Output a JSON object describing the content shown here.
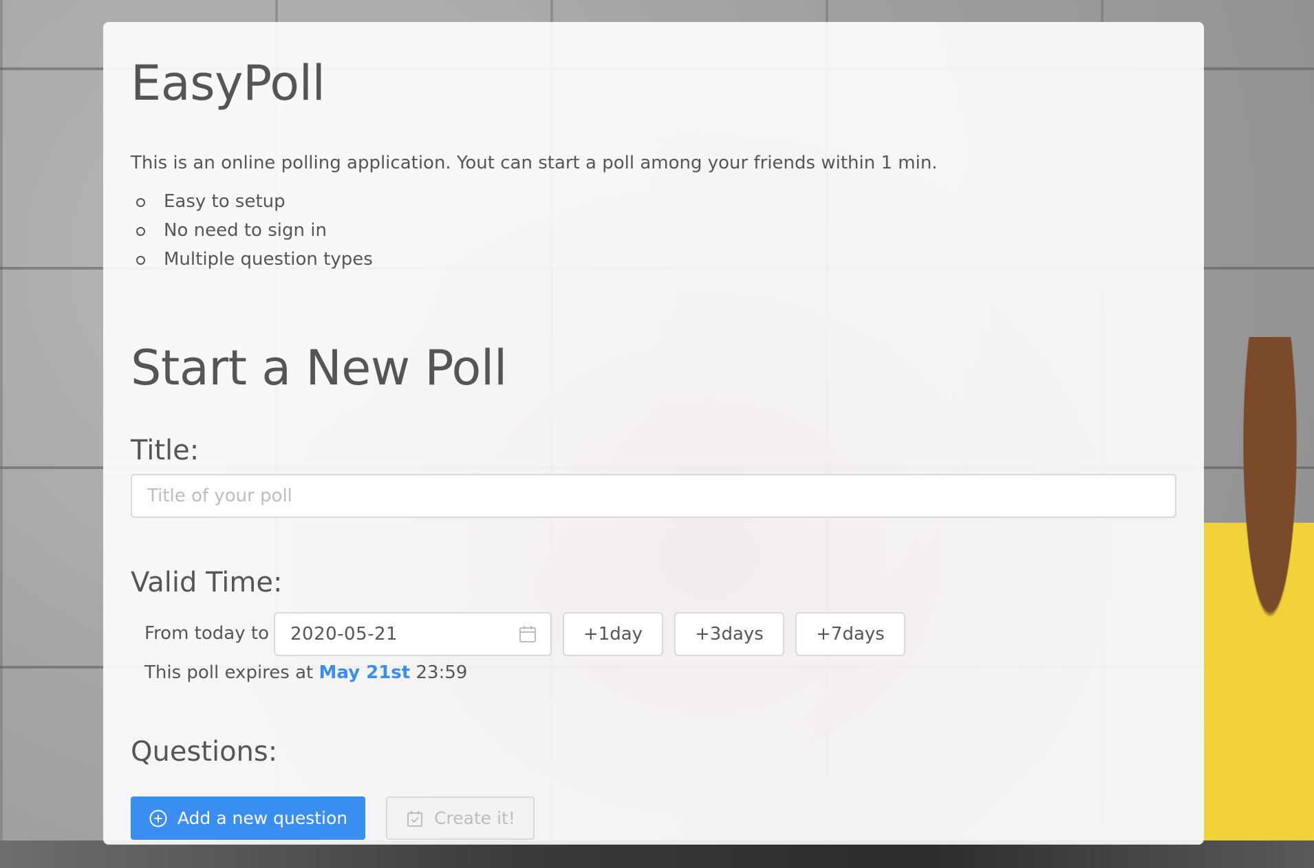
{
  "app": {
    "title": "EasyPoll",
    "intro": "This is an online polling application. Yout can start a poll among your friends within 1 min.",
    "features": [
      "Easy to setup",
      "No need to sign in",
      "Multiple question types"
    ]
  },
  "new_poll": {
    "heading": "Start a New Poll",
    "title_section": {
      "label": "Title:",
      "placeholder": "Title of your poll",
      "value": ""
    },
    "valid_time": {
      "label": "Valid Time:",
      "from_label": "From today to",
      "date_value": "2020-05-21",
      "date_icon": "calendar-icon",
      "quick_buttons": [
        "+1day",
        "+3days",
        "+7days"
      ],
      "expires_prefix": "This poll expires at",
      "expires_date": "May 21st",
      "expires_time": "23:59"
    },
    "questions": {
      "label": "Questions:",
      "add_button": "Add a new question",
      "add_icon": "plus-circle-icon",
      "create_button": "Create it!",
      "create_icon": "calendar-check-icon",
      "create_disabled": true
    }
  },
  "colors": {
    "primary": "#3a8ef0",
    "text": "#555555",
    "border": "#d9d9d9"
  }
}
